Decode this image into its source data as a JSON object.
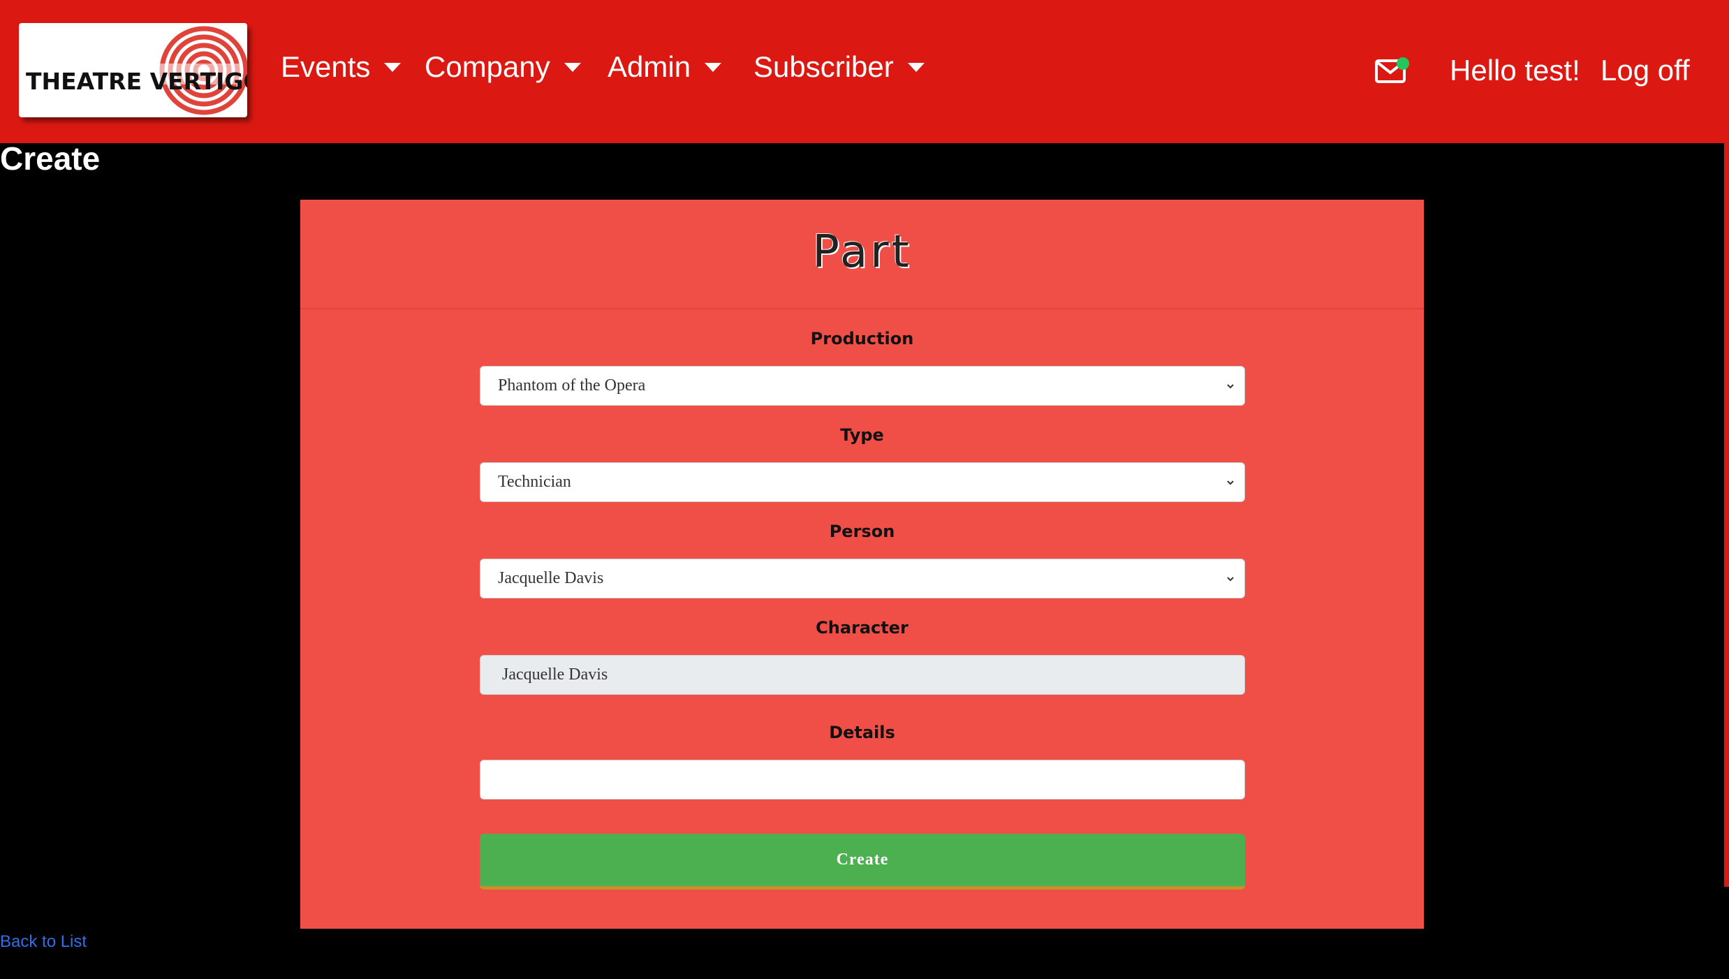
{
  "brand": {
    "logo_text": "THEATRE VERTIGO"
  },
  "nav": {
    "items": [
      {
        "label": "Events"
      },
      {
        "label": "Company"
      },
      {
        "label": "Admin"
      },
      {
        "label": "Subscriber"
      }
    ],
    "greeting": "Hello test!",
    "logoff": "Log off",
    "notification": {
      "icon": "envelope-icon",
      "status_color": "#22c55e"
    }
  },
  "page": {
    "title": "Create"
  },
  "form": {
    "heading": "Part",
    "fields": {
      "production": {
        "label": "Production",
        "value": "Phantom of the Opera"
      },
      "type": {
        "label": "Type",
        "value": "Technician"
      },
      "person": {
        "label": "Person",
        "value": "Jacquelle Davis"
      },
      "character": {
        "label": "Character",
        "value": "Jacquelle Davis"
      },
      "details": {
        "label": "Details",
        "value": ""
      }
    },
    "submit_label": "Create"
  },
  "footer": {
    "back_link": "Back to List"
  },
  "colors": {
    "navbar": "#db1912",
    "card": "#f04f48",
    "button": "#4caf50",
    "link": "#2f6fe8"
  }
}
